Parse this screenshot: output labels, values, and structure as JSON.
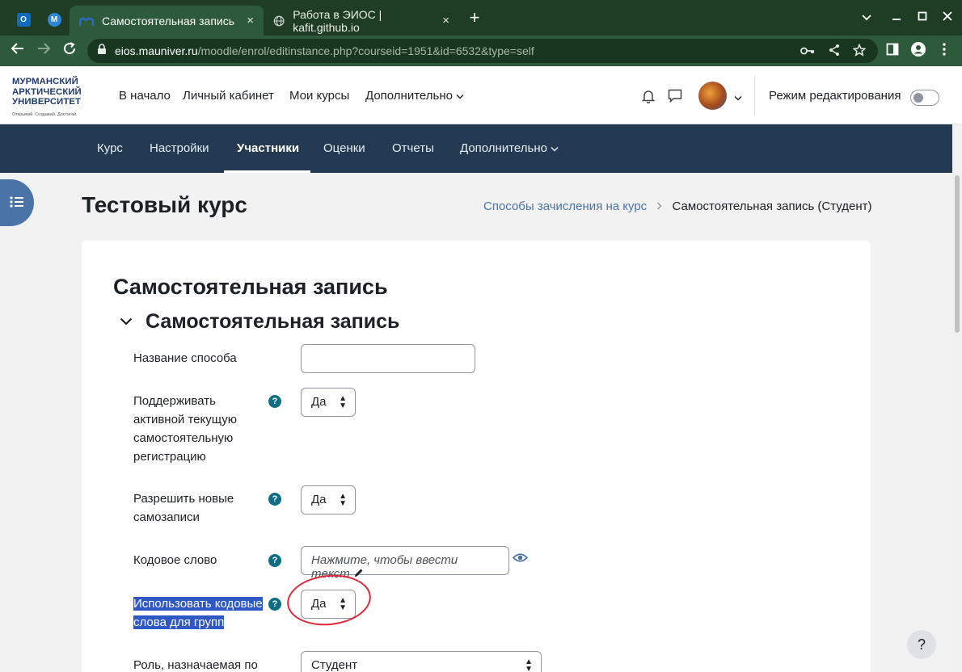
{
  "browser": {
    "tabs": [
      {
        "title": "Самостоятельная запись",
        "close": "×"
      },
      {
        "title": "Работа в ЭИОС | kafit.github.io",
        "close": "×"
      }
    ],
    "new_tab": "+",
    "url_host": "eios.mauniver.ru",
    "url_path": "/moodle/enrol/editinstance.php?courseid=1951&id=6532&type=self",
    "pinned_tabs": [
      {
        "label": "O",
        "color": "#0f6cbd"
      },
      {
        "label": "M",
        "color": "#2b88d8"
      }
    ]
  },
  "site": {
    "logo_lines": [
      "МУРМАНСКИЙ",
      "АРКТИЧЕСКИЙ",
      "УНИВЕРСИТЕТ"
    ],
    "logo_slogan": "Открывай. Создавай. Достигай.",
    "nav": [
      "В начало",
      "Личный кабинет",
      "Мои курсы",
      "Дополнительно"
    ],
    "edit_mode_label": "Режим редактирования"
  },
  "course_nav": {
    "items": [
      "Курс",
      "Настройки",
      "Участники",
      "Оценки",
      "Отчеты",
      "Дополнительно"
    ],
    "active": "Участники"
  },
  "page": {
    "course_title": "Тестовый курс",
    "breadcrumb": [
      "Способы зачисления на курс",
      "Самостоятельная запись (Студент)"
    ],
    "heading": "Самостоятельная запись",
    "section_heading": "Самостоятельная запись"
  },
  "form": {
    "name_label": "Название способа",
    "name_value": "",
    "keep_active_label": [
      "Поддерживать",
      "активной текущую",
      "самостоятельную",
      "регистрацию"
    ],
    "keep_active_value": "Да",
    "allow_new_label": [
      "Разрешить новые",
      "самозаписи"
    ],
    "allow_new_value": "Да",
    "keyword_label": "Кодовое слово",
    "keyword_placeholder": "Нажмите, чтобы ввести текст",
    "group_keys_label": [
      "Использовать кодовые",
      "слова для групп"
    ],
    "group_keys_value": "Да",
    "role_label": "Роль, назначаемая по",
    "role_value": "Студент",
    "help_glyph": "?"
  },
  "colors": {
    "chrome_dark": "#1f3d24",
    "chrome_toolbar": "#2d5a3a",
    "course_nav_bg": "#243a52",
    "link": "#4a73a8",
    "help_badge": "#0f6e83",
    "selection_highlight": "#2f57c6",
    "annotation_circle": "#e0283a"
  }
}
